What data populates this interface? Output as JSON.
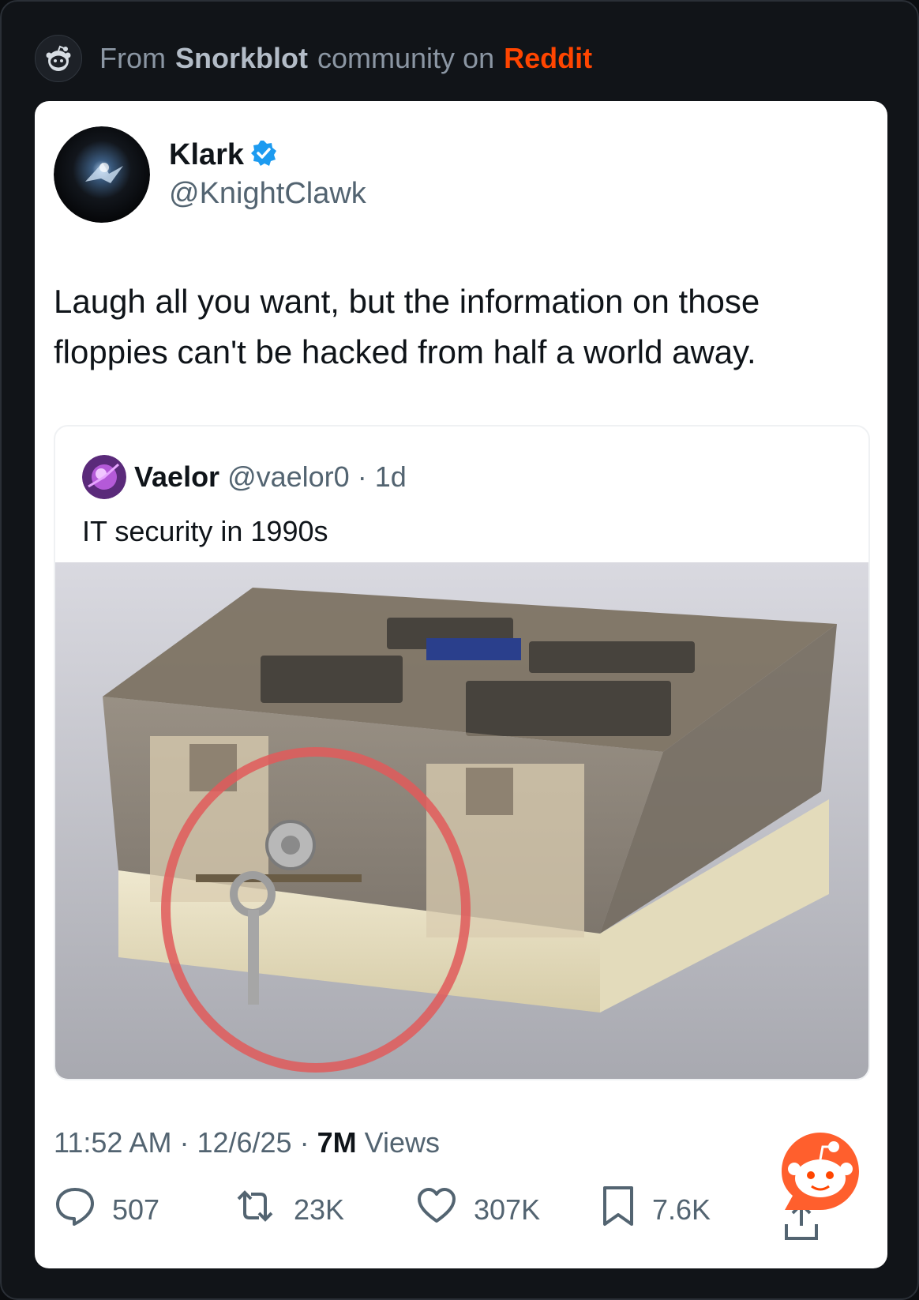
{
  "header": {
    "prefix": "From",
    "community": "Snorkblot",
    "middle": "community on",
    "platform": "Reddit",
    "icon": "reddit-alien-icon"
  },
  "tweet": {
    "author_name": "Klark",
    "verified": true,
    "author_handle": "@KnightClawk",
    "text": "Laugh all you want, but the information on those floppies can't be hacked from half a world away.",
    "quote": {
      "name": "Vaelor",
      "handle": "@vaelor0",
      "age": "· 1d",
      "text": "IT security in 1990s",
      "image": "locked floppy disk storage box with key, circled in red"
    },
    "time": "11:52 AM",
    "date": "12/6/25",
    "views_count": "7M",
    "views_label": "Views",
    "sep": "·",
    "actions": {
      "replies": "507",
      "retweets": "23K",
      "likes": "307K",
      "bookmarks": "7.6K"
    }
  },
  "colors": {
    "accent": "#ff4500",
    "verified": "#1d9bf0",
    "muted": "#536471"
  }
}
